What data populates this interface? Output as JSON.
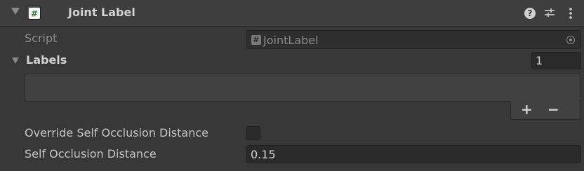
{
  "component": {
    "title": "Joint Label",
    "icons": {
      "fold": "triangle-down-icon",
      "script": "csharp-script-icon",
      "help": "help-icon",
      "presets": "presets-icon",
      "menu": "kebab-menu-icon"
    },
    "help_glyph": "?"
  },
  "script_field": {
    "label": "Script",
    "value": "JointLabel",
    "icon_glyph": "#"
  },
  "labels_list": {
    "label": "Labels",
    "count": "1",
    "add_label": "+",
    "remove_label": "−"
  },
  "override_self_occlusion": {
    "label": "Override Self Occlusion Distance",
    "checked": false
  },
  "self_occlusion_distance": {
    "label": "Self Occlusion Distance",
    "value": "0.15"
  },
  "colors": {
    "background": "#383838",
    "header": "#3e3e3e",
    "field": "#2a2a2a",
    "text": "#c4c4c4",
    "disabled_text": "#8c8c8c"
  }
}
